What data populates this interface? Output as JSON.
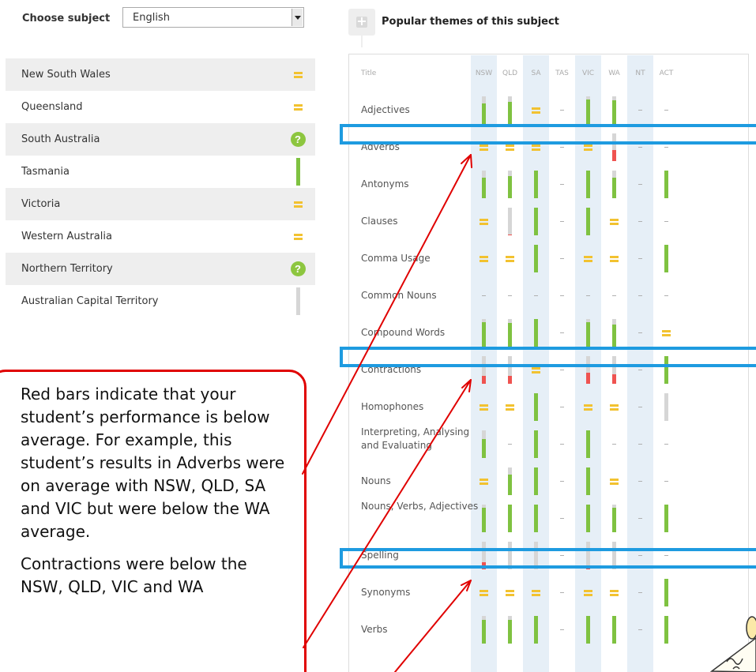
{
  "subject": {
    "label": "Choose subject",
    "selected": "English"
  },
  "states": [
    {
      "name": "New South Wales",
      "indicator": "equal"
    },
    {
      "name": "Queensland",
      "indicator": "equal"
    },
    {
      "name": "South Australia",
      "indicator": "question"
    },
    {
      "name": "Tasmania",
      "indicator": "bar",
      "level": 1.0,
      "color": "green"
    },
    {
      "name": "Victoria",
      "indicator": "equal"
    },
    {
      "name": "Western Australia",
      "indicator": "equal"
    },
    {
      "name": "Northern Territory",
      "indicator": "question"
    },
    {
      "name": "Australian Capital Territory",
      "indicator": "bar",
      "level": 0,
      "color": "grey"
    }
  ],
  "themes_panel": {
    "title": "Popular themes of this subject",
    "title_column": "Title",
    "columns": [
      "NSW",
      "QLD",
      "SA",
      "TAS",
      "VIC",
      "WA",
      "NT",
      "ACT"
    ],
    "rows": [
      {
        "title": "Adjectives",
        "cells": [
          {
            "t": "bar",
            "v": 0.75,
            "c": "green"
          },
          {
            "t": "bar",
            "v": 0.8,
            "c": "green"
          },
          {
            "t": "equal"
          },
          {
            "t": "dash"
          },
          {
            "t": "bar",
            "v": 0.9,
            "c": "green"
          },
          {
            "t": "bar",
            "v": 0.85,
            "c": "green"
          },
          {
            "t": "dash"
          },
          {
            "t": "dash"
          }
        ]
      },
      {
        "title": "Adverbs",
        "cells": [
          {
            "t": "equal"
          },
          {
            "t": "equal"
          },
          {
            "t": "equal"
          },
          {
            "t": "dash"
          },
          {
            "t": "equal"
          },
          {
            "t": "bar",
            "v": 0.4,
            "c": "red"
          },
          {
            "t": "dash"
          },
          {
            "t": "dash"
          }
        ]
      },
      {
        "title": "Antonyms",
        "cells": [
          {
            "t": "bar",
            "v": 0.75,
            "c": "green"
          },
          {
            "t": "bar",
            "v": 0.8,
            "c": "green"
          },
          {
            "t": "bar",
            "v": 1.0,
            "c": "green"
          },
          {
            "t": "dash"
          },
          {
            "t": "bar",
            "v": 1.0,
            "c": "green"
          },
          {
            "t": "bar",
            "v": 0.75,
            "c": "green"
          },
          {
            "t": "dash"
          },
          {
            "t": "bar",
            "v": 1.0,
            "c": "green"
          }
        ]
      },
      {
        "title": "Clauses",
        "cells": [
          {
            "t": "equal"
          },
          {
            "t": "bar",
            "v": 0.03,
            "c": "red"
          },
          {
            "t": "bar",
            "v": 1.0,
            "c": "green"
          },
          {
            "t": "dash"
          },
          {
            "t": "bar",
            "v": 1.0,
            "c": "green"
          },
          {
            "t": "equal"
          },
          {
            "t": "dash"
          },
          {
            "t": "dash"
          }
        ]
      },
      {
        "title": "Comma Usage",
        "cells": [
          {
            "t": "equal"
          },
          {
            "t": "equal"
          },
          {
            "t": "bar",
            "v": 1.0,
            "c": "green"
          },
          {
            "t": "dash"
          },
          {
            "t": "equal"
          },
          {
            "t": "equal"
          },
          {
            "t": "dash"
          },
          {
            "t": "bar",
            "v": 1.0,
            "c": "green"
          }
        ]
      },
      {
        "title": "Common Nouns",
        "cells": [
          {
            "t": "dash"
          },
          {
            "t": "dash"
          },
          {
            "t": "dash"
          },
          {
            "t": "dash"
          },
          {
            "t": "dash"
          },
          {
            "t": "dash"
          },
          {
            "t": "dash"
          },
          {
            "t": "dash"
          }
        ]
      },
      {
        "title": "Compound Words",
        "cells": [
          {
            "t": "bar",
            "v": 0.9,
            "c": "green"
          },
          {
            "t": "bar",
            "v": 0.85,
            "c": "green"
          },
          {
            "t": "bar",
            "v": 1.0,
            "c": "green"
          },
          {
            "t": "dash"
          },
          {
            "t": "bar",
            "v": 0.9,
            "c": "green"
          },
          {
            "t": "bar",
            "v": 0.8,
            "c": "green"
          },
          {
            "t": "dash"
          },
          {
            "t": "equal"
          }
        ]
      },
      {
        "title": "Contractions",
        "cells": [
          {
            "t": "bar",
            "v": 0.3,
            "c": "red"
          },
          {
            "t": "bar",
            "v": 0.3,
            "c": "red"
          },
          {
            "t": "equal"
          },
          {
            "t": "dash"
          },
          {
            "t": "bar",
            "v": 0.4,
            "c": "red"
          },
          {
            "t": "bar",
            "v": 0.35,
            "c": "red"
          },
          {
            "t": "dash"
          },
          {
            "t": "bar",
            "v": 1.0,
            "c": "green"
          }
        ]
      },
      {
        "title": "Homophones",
        "cells": [
          {
            "t": "equal"
          },
          {
            "t": "equal"
          },
          {
            "t": "bar",
            "v": 1.0,
            "c": "green"
          },
          {
            "t": "dash"
          },
          {
            "t": "equal"
          },
          {
            "t": "equal"
          },
          {
            "t": "dash"
          },
          {
            "t": "bar",
            "v": 0,
            "c": "grey"
          }
        ]
      },
      {
        "title": "Interpreting, Analysing and Evaluating",
        "cells": [
          {
            "t": "bar",
            "v": 0.7,
            "c": "green"
          },
          {
            "t": "dash"
          },
          {
            "t": "bar",
            "v": 1.0,
            "c": "green"
          },
          {
            "t": "dash"
          },
          {
            "t": "bar",
            "v": 1.0,
            "c": "green"
          },
          {
            "t": "dash"
          },
          {
            "t": "dash"
          },
          {
            "t": "dash"
          }
        ]
      },
      {
        "title": "Nouns",
        "cells": [
          {
            "t": "equal"
          },
          {
            "t": "bar",
            "v": 0.75,
            "c": "green"
          },
          {
            "t": "bar",
            "v": 1.0,
            "c": "green"
          },
          {
            "t": "dash"
          },
          {
            "t": "bar",
            "v": 1.0,
            "c": "green"
          },
          {
            "t": "equal"
          },
          {
            "t": "dash"
          },
          {
            "t": "dash"
          }
        ]
      },
      {
        "title": "Nouns, Verbs, Adjectives",
        "cells": [
          {
            "t": "bar",
            "v": 0.9,
            "c": "green"
          },
          {
            "t": "bar",
            "v": 1.0,
            "c": "green"
          },
          {
            "t": "bar",
            "v": 1.0,
            "c": "green"
          },
          {
            "t": "dash"
          },
          {
            "t": "bar",
            "v": 1.0,
            "c": "green"
          },
          {
            "t": "bar",
            "v": 0.9,
            "c": "green"
          },
          {
            "t": "dash"
          },
          {
            "t": "bar",
            "v": 1.0,
            "c": "green"
          }
        ]
      },
      {
        "title": "Spelling",
        "cells": [
          {
            "t": "bar",
            "v": 0.25,
            "c": "red"
          },
          {
            "t": "bar",
            "v": 0,
            "c": "grey"
          },
          {
            "t": "bar",
            "v": 0,
            "c": "grey"
          },
          {
            "t": "dash"
          },
          {
            "t": "bar",
            "v": 0.1,
            "c": "red"
          },
          {
            "t": "bar",
            "v": 0,
            "c": "grey"
          },
          {
            "t": "dash"
          },
          {
            "t": "dash"
          }
        ]
      },
      {
        "title": "Synonyms",
        "cells": [
          {
            "t": "equal"
          },
          {
            "t": "equal"
          },
          {
            "t": "equal"
          },
          {
            "t": "dash"
          },
          {
            "t": "equal"
          },
          {
            "t": "equal"
          },
          {
            "t": "dash"
          },
          {
            "t": "bar",
            "v": 1.0,
            "c": "green"
          }
        ]
      },
      {
        "title": "Verbs",
        "cells": [
          {
            "t": "bar",
            "v": 0.85,
            "c": "green"
          },
          {
            "t": "bar",
            "v": 0.85,
            "c": "green"
          },
          {
            "t": "bar",
            "v": 1.0,
            "c": "green"
          },
          {
            "t": "dash"
          },
          {
            "t": "bar",
            "v": 1.0,
            "c": "green"
          },
          {
            "t": "bar",
            "v": 1.0,
            "c": "green"
          },
          {
            "t": "dash"
          },
          {
            "t": "bar",
            "v": 1.0,
            "c": "green"
          }
        ]
      }
    ]
  },
  "callout": {
    "paragraph1": "Red bars indicate that your student’s performance is below average. For example, this student’s results in Adverbs were on average with NSW, QLD, SA and VIC but were below the WA average.",
    "paragraph2": "Contractions were below the NSW, QLD, VIC and WA"
  },
  "colors": {
    "green": "#7fc241",
    "red": "#ef5350",
    "grey": "#d6d6d6",
    "yellow": "#f2c230",
    "highlight_box": "#1e9be0",
    "arrow": "#e00000",
    "column_stripe": "#e6eff7"
  },
  "icons": {
    "equal": "equal-icon",
    "question": "question-circle-icon",
    "dash": "dash-icon",
    "subject_badge": "plus-badge-icon"
  }
}
